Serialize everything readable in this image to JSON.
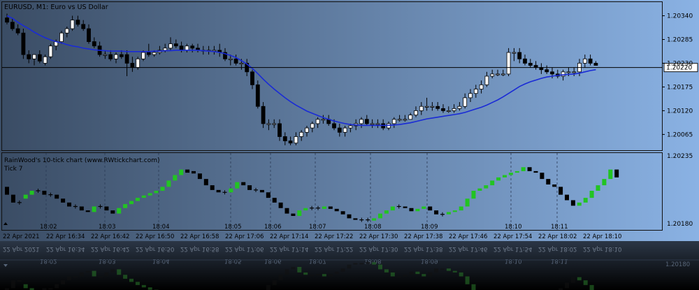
{
  "colors": {
    "background_left": "#3a4c64",
    "background_right": "#8ab2e4",
    "frame": "#1a1a1a",
    "bull_body": "#ffffff",
    "bear_body": "#000000",
    "wick": "#000000",
    "ma_line": "#1a2bd6",
    "price_line": "#000000",
    "tick_up": "#22c422",
    "tick_down": "#000000",
    "text": "#000000"
  },
  "chart_data": [
    {
      "type": "candlestick",
      "title": "EURUSD, M1:  Euro vs US Dollar",
      "current_price": "1.20220",
      "ylim": [
        1.2003,
        1.2037
      ],
      "ticks": [
        "1.20340",
        "1.20285",
        "1.20230",
        "1.20175",
        "1.20120",
        "1.20065"
      ],
      "overlay": "moving-average",
      "series": {
        "o": [
          1.20335,
          1.20325,
          1.2031,
          1.203,
          1.2025,
          1.2024,
          1.2025,
          1.2023,
          1.20245,
          1.2027,
          1.2028,
          1.203,
          1.2031,
          1.2033,
          1.2032,
          1.2031,
          1.2028,
          1.2027,
          1.2025,
          1.2025,
          1.2024,
          1.2025,
          1.2025,
          1.2023,
          1.2022,
          1.2024,
          1.20255,
          1.2025,
          1.20255,
          1.2026,
          1.20265,
          1.20275,
          1.2027,
          1.2026,
          1.2027,
          1.20265,
          1.2026,
          1.2026,
          1.2026,
          1.2026,
          1.20255,
          1.2024,
          1.2024,
          1.2023,
          1.2023,
          1.2021,
          1.2018,
          1.2013,
          1.2009,
          1.2009,
          1.2009,
          1.2006,
          1.2005,
          1.20045,
          1.2006,
          1.2007,
          1.2008,
          1.2009,
          1.201,
          1.201,
          1.2009,
          1.2008,
          1.2007,
          1.2008,
          1.20085,
          1.2009,
          1.201,
          1.2009,
          1.2009,
          1.2009,
          1.2008,
          1.2009,
          1.201,
          1.201,
          1.201,
          1.2011,
          1.2012,
          1.2013,
          1.2013,
          1.2013,
          1.20125,
          1.2012,
          1.2012,
          1.20125,
          1.2013,
          1.2015,
          1.2016,
          1.2017,
          1.2018,
          1.202,
          1.20205,
          1.20205,
          1.20205,
          1.20255,
          1.20255,
          1.2024,
          1.2023,
          1.20225,
          1.2022,
          1.20215,
          1.2021,
          1.20205,
          1.202,
          1.2021,
          1.2021,
          1.2021,
          1.2023,
          1.2024,
          1.2023
        ],
        "h": [
          1.20345,
          1.20335,
          1.2032,
          1.2031,
          1.2026,
          1.2025,
          1.2026,
          1.2025,
          1.20275,
          1.20285,
          1.20305,
          1.20315,
          1.2034,
          1.2034,
          1.2033,
          1.2032,
          1.2029,
          1.2028,
          1.2026,
          1.2026,
          1.20255,
          1.2026,
          1.2026,
          1.20245,
          1.20245,
          1.2026,
          1.20275,
          1.2026,
          1.2027,
          1.20275,
          1.2029,
          1.20285,
          1.2028,
          1.20275,
          1.20275,
          1.20275,
          1.2027,
          1.2027,
          1.2027,
          1.20275,
          1.20265,
          1.2025,
          1.2025,
          1.2024,
          1.2024,
          1.20215,
          1.2019,
          1.2014,
          1.201,
          1.201,
          1.201,
          1.2007,
          1.2006,
          1.2007,
          1.20075,
          1.20085,
          1.20095,
          1.20105,
          1.2011,
          1.2011,
          1.201,
          1.2009,
          1.20085,
          1.2009,
          1.201,
          1.20105,
          1.2011,
          1.201,
          1.201,
          1.201,
          1.20095,
          1.20105,
          1.2011,
          1.2011,
          1.20115,
          1.2013,
          1.2014,
          1.2015,
          1.2014,
          1.2014,
          1.20135,
          1.2013,
          1.20135,
          1.2014,
          1.2016,
          1.2017,
          1.2018,
          1.2019,
          1.2021,
          1.20215,
          1.20215,
          1.20215,
          1.20265,
          1.20265,
          1.20265,
          1.2025,
          1.2024,
          1.20235,
          1.2023,
          1.20225,
          1.2022,
          1.20215,
          1.20215,
          1.2022,
          1.2022,
          1.2024,
          1.2025,
          1.2025,
          1.20235
        ],
        "l": [
          1.2032,
          1.20305,
          1.20295,
          1.2024,
          1.2023,
          1.20225,
          1.2023,
          1.20225,
          1.2024,
          1.2026,
          1.20275,
          1.2029,
          1.20305,
          1.20315,
          1.20305,
          1.20275,
          1.20265,
          1.20245,
          1.2024,
          1.20235,
          1.2023,
          1.2024,
          1.202,
          1.2021,
          1.20215,
          1.20235,
          1.20245,
          1.20245,
          1.2025,
          1.20255,
          1.2026,
          1.20265,
          1.20255,
          1.20255,
          1.20255,
          1.20255,
          1.2025,
          1.2025,
          1.2025,
          1.20245,
          1.20235,
          1.20225,
          1.20225,
          1.20215,
          1.202,
          1.2017,
          1.20125,
          1.2008,
          1.20075,
          1.2008,
          1.2005,
          1.2004,
          1.2004,
          1.2004,
          1.2005,
          1.2006,
          1.2007,
          1.2008,
          1.2009,
          1.20085,
          1.20075,
          1.2006,
          1.2006,
          1.2007,
          1.20075,
          1.2008,
          1.20085,
          1.2008,
          1.2008,
          1.20075,
          1.20075,
          1.2008,
          1.20095,
          1.20095,
          1.201,
          1.20105,
          1.2011,
          1.2012,
          1.2012,
          1.2012,
          1.20115,
          1.20115,
          1.20115,
          1.2012,
          1.20125,
          1.2014,
          1.2015,
          1.2016,
          1.20175,
          1.20195,
          1.202,
          1.202,
          1.202,
          1.20235,
          1.2023,
          1.20225,
          1.2022,
          1.20215,
          1.20205,
          1.20205,
          1.20195,
          1.20195,
          1.2019,
          1.202,
          1.202,
          1.202,
          1.2022,
          1.20225,
          1.20225
        ],
        "c": [
          1.20325,
          1.2031,
          1.203,
          1.2025,
          1.2024,
          1.2025,
          1.20235,
          1.20245,
          1.2027,
          1.2028,
          1.203,
          1.2031,
          1.2033,
          1.2032,
          1.2031,
          1.2028,
          1.2027,
          1.2025,
          1.2025,
          1.2024,
          1.2025,
          1.20245,
          1.2023,
          1.2022,
          1.2024,
          1.20255,
          1.2025,
          1.20255,
          1.2026,
          1.20265,
          1.20275,
          1.2027,
          1.2026,
          1.2027,
          1.20265,
          1.2026,
          1.2026,
          1.2026,
          1.2026,
          1.20255,
          1.2024,
          1.2024,
          1.2023,
          1.2023,
          1.2021,
          1.2018,
          1.2013,
          1.2009,
          1.2009,
          1.2009,
          1.2006,
          1.2005,
          1.20045,
          1.2006,
          1.2007,
          1.2008,
          1.2009,
          1.201,
          1.201,
          1.2009,
          1.2008,
          1.2007,
          1.2008,
          1.20085,
          1.2009,
          1.201,
          1.2009,
          1.2009,
          1.2009,
          1.2008,
          1.2009,
          1.201,
          1.201,
          1.201,
          1.2011,
          1.2012,
          1.2013,
          1.2013,
          1.2013,
          1.20125,
          1.2012,
          1.2012,
          1.20125,
          1.2013,
          1.2015,
          1.2016,
          1.2017,
          1.2018,
          1.202,
          1.20205,
          1.20205,
          1.20205,
          1.20255,
          1.20255,
          1.2024,
          1.2023,
          1.20225,
          1.2022,
          1.20215,
          1.2021,
          1.20205,
          1.202,
          1.2021,
          1.2021,
          1.2021,
          1.2023,
          1.2024,
          1.2023,
          1.20225
        ]
      },
      "ma": [
        1.2034,
        1.20334,
        1.20325,
        1.20317,
        1.2031,
        1.20302,
        1.20295,
        1.20289,
        1.20284,
        1.2028,
        1.20277,
        1.20273,
        1.2027,
        1.20268,
        1.20265,
        1.20263,
        1.20261,
        1.2026,
        1.20259,
        1.20258,
        1.20258,
        1.20258,
        1.20257,
        1.20257,
        1.20257,
        1.20257,
        1.20257,
        1.20258,
        1.20258,
        1.20259,
        1.20259,
        1.2026,
        1.2026,
        1.2026,
        1.2026,
        1.2026,
        1.20259,
        1.20258,
        1.20257,
        1.20255,
        1.20252,
        1.20248,
        1.20243,
        1.20236,
        1.20228,
        1.20218,
        1.20206,
        1.20193,
        1.20181,
        1.2017,
        1.2016,
        1.2015,
        1.20141,
        1.20133,
        1.20126,
        1.20119,
        1.20114,
        1.20109,
        1.20104,
        1.201,
        1.20096,
        1.20093,
        1.2009,
        1.20088,
        1.20087,
        1.20086,
        1.20086,
        1.20086,
        1.20086,
        1.20086,
        1.20086,
        1.20087,
        1.20088,
        1.2009,
        1.20092,
        1.20095,
        1.20098,
        1.20101,
        1.20103,
        1.20105,
        1.20107,
        1.20109,
        1.20111,
        1.20113,
        1.20116,
        1.2012,
        1.20124,
        1.20128,
        1.20133,
        1.20139,
        1.20145,
        1.20152,
        1.2016,
        1.20168,
        1.20176,
        1.20182,
        1.20187,
        1.20191,
        1.20195,
        1.20198,
        1.202,
        1.20202,
        1.20203,
        1.20204,
        1.20205,
        1.20207,
        1.2021,
        1.20213,
        1.20215
      ]
    },
    {
      "type": "tick-bars",
      "title": "RainWood's 10-tick chart  (www.RWtickchart.com)",
      "subtitle": "Tick 7",
      "ylim": [
        1.20165,
        1.20245
      ],
      "ticks": [
        "1.20235",
        "1.20180"
      ],
      "bars": [
        [
          1.2021,
          1.202
        ],
        [
          1.202,
          1.2019
        ],
        [
          1.2019,
          1.2019
        ],
        [
          1.20195,
          1.202
        ],
        [
          1.202,
          1.20205
        ],
        [
          1.20205,
          1.20205
        ],
        [
          1.20205,
          1.202
        ],
        [
          1.202,
          1.202
        ],
        [
          1.202,
          1.20195
        ],
        [
          1.20195,
          1.2019
        ],
        [
          1.2019,
          1.20185
        ],
        [
          1.20185,
          1.20185
        ],
        [
          1.20185,
          1.2018
        ],
        [
          1.2018,
          1.20178
        ],
        [
          1.20178,
          1.20185
        ],
        [
          1.20185,
          1.20185
        ],
        [
          1.20185,
          1.2018
        ],
        [
          1.2018,
          1.20176
        ],
        [
          1.20176,
          1.20183
        ],
        [
          1.20183,
          1.20188
        ],
        [
          1.20188,
          1.20192
        ],
        [
          1.20192,
          1.20196
        ],
        [
          1.20196,
          1.20199
        ],
        [
          1.20199,
          1.20202
        ],
        [
          1.20202,
          1.20205
        ],
        [
          1.20205,
          1.2021
        ],
        [
          1.2021,
          1.20218
        ],
        [
          1.20218,
          1.20225
        ],
        [
          1.20225,
          1.20232
        ],
        [
          1.20232,
          1.20228
        ],
        [
          1.2023,
          1.20227
        ],
        [
          1.20227,
          1.2022
        ],
        [
          1.2022,
          1.20212
        ],
        [
          1.20212,
          1.20206
        ],
        [
          1.20206,
          1.20203
        ],
        [
          1.20203,
          1.20203
        ],
        [
          1.20203,
          1.20208
        ],
        [
          1.20208,
          1.20216
        ],
        [
          1.20216,
          1.20212
        ],
        [
          1.20212,
          1.20206
        ],
        [
          1.20206,
          1.20206
        ],
        [
          1.20206,
          1.20203
        ],
        [
          1.20203,
          1.20196
        ],
        [
          1.20196,
          1.2019
        ],
        [
          1.2019,
          1.20183
        ],
        [
          1.20183,
          1.20176
        ],
        [
          1.20176,
          1.20173
        ],
        [
          1.20173,
          1.2018
        ],
        [
          1.2018,
          1.20183
        ],
        [
          1.20183,
          1.20183
        ],
        [
          1.20183,
          1.20182
        ],
        [
          1.20182,
          1.20185
        ],
        [
          1.20185,
          1.20182
        ],
        [
          1.20182,
          1.20179
        ],
        [
          1.20179,
          1.20175
        ],
        [
          1.20175,
          1.2017
        ],
        [
          1.2017,
          1.20168
        ],
        [
          1.20168,
          1.20168
        ],
        [
          1.20168,
          1.20167
        ],
        [
          1.20167,
          1.2017
        ],
        [
          1.2017,
          1.20176
        ],
        [
          1.20176,
          1.2018
        ],
        [
          1.2018,
          1.20185
        ],
        [
          1.20185,
          1.20185
        ],
        [
          1.20185,
          1.20183
        ],
        [
          1.20183,
          1.20179
        ],
        [
          1.20179,
          1.20182
        ],
        [
          1.20182,
          1.20185
        ],
        [
          1.20185,
          1.2018
        ],
        [
          1.2018,
          1.20175
        ],
        [
          1.20175,
          1.20175
        ],
        [
          1.20175,
          1.20178
        ],
        [
          1.20178,
          1.2018
        ],
        [
          1.2018,
          1.20185
        ],
        [
          1.20185,
          1.20195
        ],
        [
          1.20195,
          1.20205
        ],
        [
          1.20205,
          1.20208
        ],
        [
          1.20208,
          1.20212
        ],
        [
          1.20212,
          1.20218
        ],
        [
          1.20218,
          1.20222
        ],
        [
          1.20222,
          1.20225
        ],
        [
          1.20225,
          1.20228
        ],
        [
          1.20228,
          1.2023
        ],
        [
          1.2023,
          1.20235
        ],
        [
          1.20235,
          1.2023
        ],
        [
          1.2023,
          1.20228
        ],
        [
          1.20228,
          1.2022
        ],
        [
          1.2022,
          1.20213
        ],
        [
          1.20213,
          1.2021
        ],
        [
          1.2021,
          1.202
        ],
        [
          1.202,
          1.20193
        ],
        [
          1.20193,
          1.20186
        ],
        [
          1.20186,
          1.2019
        ],
        [
          1.2019,
          1.20196
        ],
        [
          1.20196,
          1.20205
        ],
        [
          1.20205,
          1.20212
        ],
        [
          1.20212,
          1.2022
        ],
        [
          1.2022,
          1.20232
        ],
        [
          1.20232,
          1.20222
        ]
      ]
    }
  ],
  "time_labels": {
    "main_top": [
      "18:02",
      "18:03",
      "18:04",
      "18:05",
      "18:06",
      "18:07",
      "18:08",
      "18:09",
      "18:10",
      "18:11"
    ],
    "main_bottom": [
      "22 Apr 2021",
      "22 Apr 16:34",
      "22 Apr 16:42",
      "22 Apr 16:50",
      "22 Apr 16:58",
      "22 Apr 17:06",
      "22 Apr 17:14",
      "22 Apr 17:22",
      "22 Apr 17:30",
      "22 Apr 17:38",
      "22 Apr 17:46",
      "22 Apr 17:54",
      "22 Apr 18:02",
      "22 Apr 18:10"
    ],
    "reflection_top": [
      "22 Apr 2021",
      "22 Apr 16:34",
      "22 Apr 16:42",
      "22 Apr 16:50",
      "22 Apr 16:58",
      "22 Apr 17:06",
      "22 Apr 17:14",
      "22 Apr 17:22",
      "22 Apr 17:30",
      "22 Apr 17:38",
      "22 Apr 17:46",
      "22 Apr 17:54",
      "22 Apr 18:02",
      "22 Apr 18:10"
    ],
    "reflection_bottom": [
      "18:02",
      "18:03",
      "18:04",
      "18:05",
      "18:06",
      "18:07",
      "18:08",
      "18:09",
      "18:10",
      "18:11"
    ],
    "reflection_price": "1.20180"
  }
}
